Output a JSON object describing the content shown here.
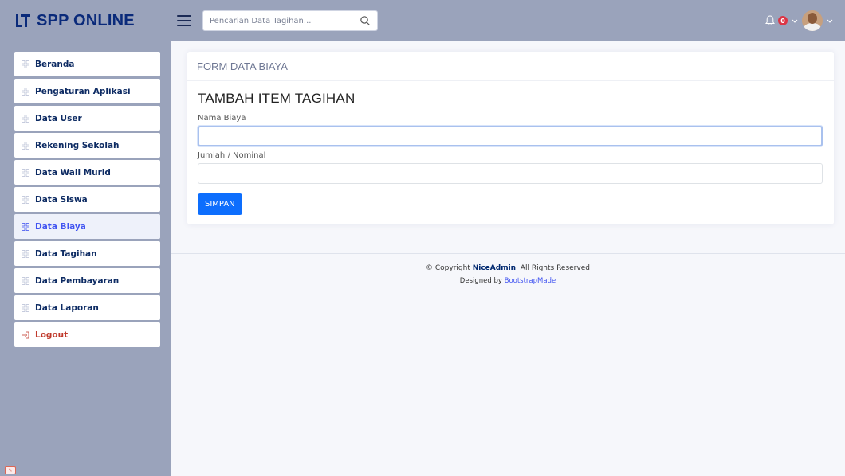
{
  "header": {
    "brand": "SPP ONLINE",
    "search_placeholder": "Pencarian Data Tagihan...",
    "notification_count": "0"
  },
  "sidebar": {
    "items": [
      {
        "label": "Beranda"
      },
      {
        "label": "Pengaturan Aplikasi"
      },
      {
        "label": "Data User"
      },
      {
        "label": "Rekening Sekolah"
      },
      {
        "label": "Data Wali Murid"
      },
      {
        "label": "Data Siswa"
      },
      {
        "label": "Data Biaya",
        "active": true
      },
      {
        "label": "Data Tagihan"
      },
      {
        "label": "Data Pembayaran"
      },
      {
        "label": "Data Laporan"
      }
    ],
    "logout_label": "Logout"
  },
  "card": {
    "header_title": "FORM DATA BIAYA",
    "form_title": "TAMBAH ITEM TAGIHAN",
    "field_name_label": "Nama Biaya",
    "field_name_value": "",
    "field_amount_label": "Jumlah / Nominal",
    "field_amount_value": "",
    "save_label": "SIMPAN"
  },
  "footer": {
    "copyright_prefix": "© Copyright ",
    "copyright_brand": "NiceAdmin",
    "copyright_suffix": ". All Rights Reserved",
    "designed_prefix": "Designed by ",
    "designed_link": "BootstrapMade"
  },
  "colors": {
    "sidebar_bg": "#9aa3bb",
    "accent": "#4154f1",
    "primary_button": "#0d6efd",
    "brand_text": "#0a2a7a"
  }
}
